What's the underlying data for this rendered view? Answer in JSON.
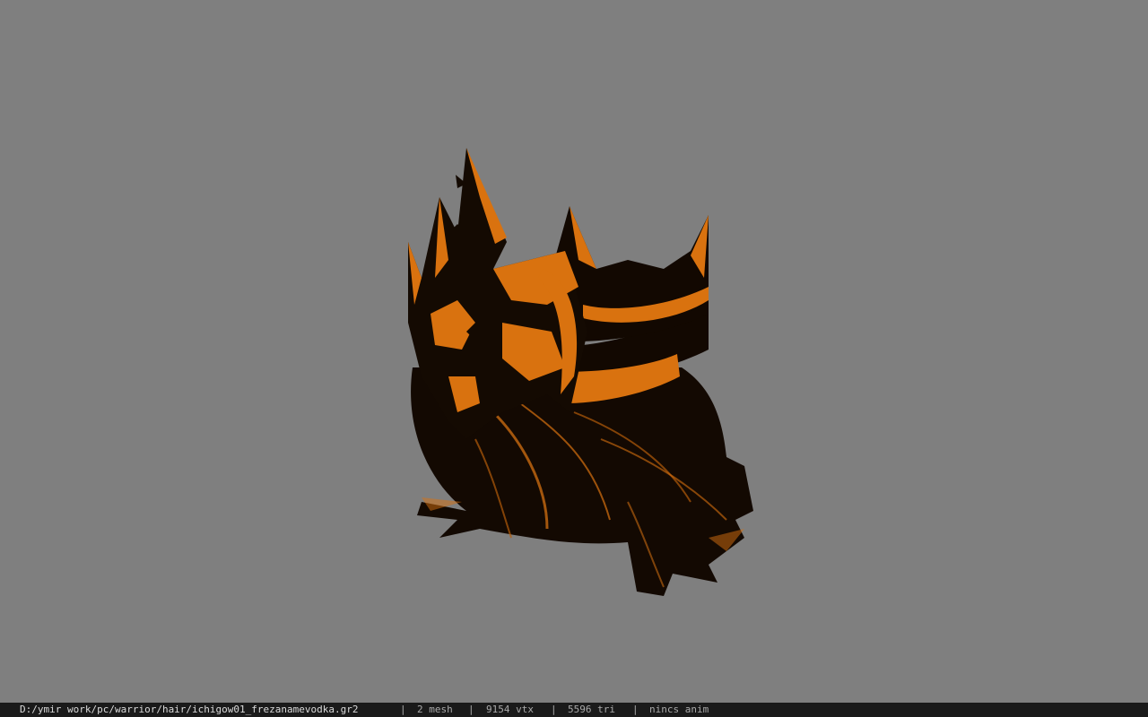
{
  "viewer": {
    "background_color": "#7f7f7f",
    "model_primary_color": "#d9720f",
    "model_shadow_color": "#140a02"
  },
  "status_bar": {
    "file_path": "D:/ymir work/pc/warrior/hair/ichigow01_frezanamevodka.gr2",
    "separator": "|",
    "mesh_count": "2 mesh",
    "vertex_count": "9154 vtx",
    "triangle_count": "5596 tri",
    "anim_status": "nincs anim"
  }
}
